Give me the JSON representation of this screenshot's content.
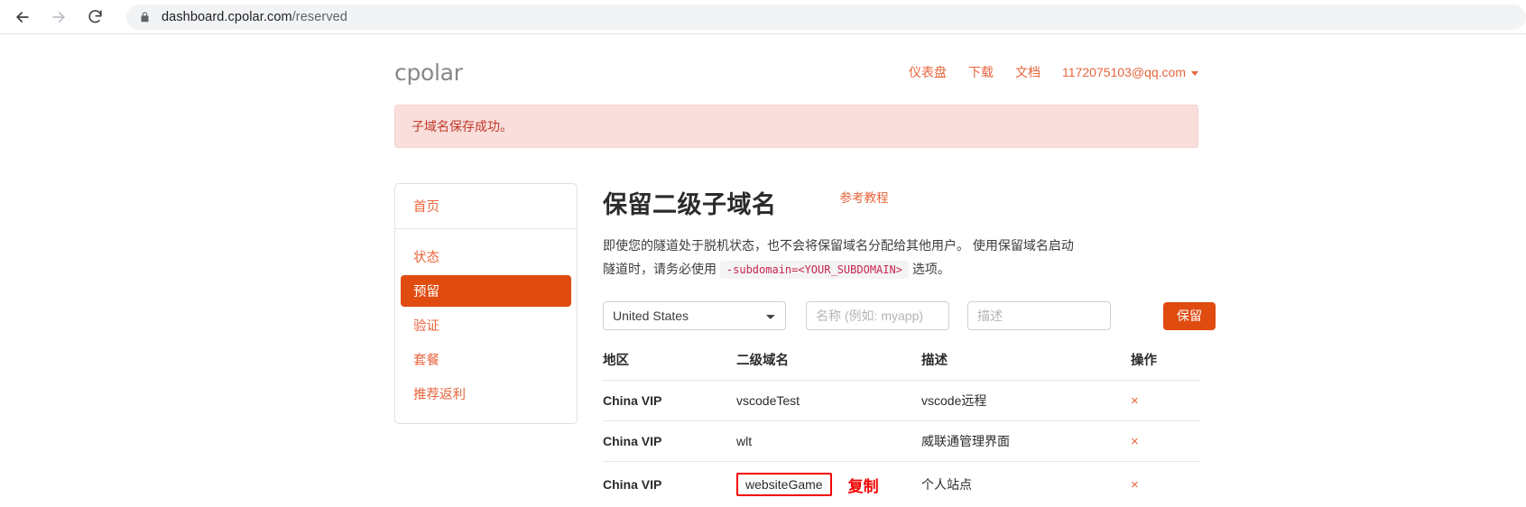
{
  "browser": {
    "back_icon": "arrow-left-icon",
    "forward_icon": "arrow-right-icon",
    "reload_icon": "reload-icon",
    "lock_icon": "lock-icon",
    "url_host": "dashboard.cpolar.com",
    "url_path": "/reserved"
  },
  "header": {
    "logo": "cpolar",
    "nav": [
      {
        "label": "仪表盘"
      },
      {
        "label": "下载"
      },
      {
        "label": "文档"
      },
      {
        "label": "1172075103@qq.com"
      }
    ]
  },
  "alert": {
    "message": "子域名保存成功。",
    "bg": "#f9dedb",
    "text_color": "#c0392b"
  },
  "sidebar": {
    "home": {
      "label": "首页"
    },
    "items": [
      {
        "label": "状态",
        "active": false
      },
      {
        "label": "预留",
        "active": true
      },
      {
        "label": "验证",
        "active": false
      },
      {
        "label": "套餐",
        "active": false
      },
      {
        "label": "推荐返利",
        "active": false
      }
    ],
    "active_bg": "#e04b10"
  },
  "main": {
    "title": "保留二级子域名",
    "tutorial_link": "参考教程",
    "description_part1": "即使您的隧道处于脱机状态，也不会将保留域名分配给其他用户。 使用保留域名启动隧道时，请务必使用",
    "description_code": "-subdomain=<YOUR_SUBDOMAIN>",
    "description_part2": "选项。",
    "form": {
      "region_value": "United States",
      "region_options": [
        "United States"
      ],
      "name_placeholder": "名称 (例如: myapp)",
      "name_value": "",
      "desc_placeholder": "描述",
      "desc_value": "",
      "submit_label": "保留"
    },
    "table": {
      "headers": [
        "地区",
        "二级域名",
        "描述",
        "操作"
      ],
      "rows": [
        {
          "region": "China VIP",
          "domain": "vscodeTest",
          "desc": "vscode远程",
          "action": "×",
          "highlighted": false,
          "annotation": ""
        },
        {
          "region": "China VIP",
          "domain": "wlt",
          "desc": "威联通管理界面",
          "action": "×",
          "highlighted": false,
          "annotation": ""
        },
        {
          "region": "China VIP",
          "domain": "websiteGame",
          "desc": "个人站点",
          "action": "×",
          "highlighted": true,
          "annotation": "复制"
        }
      ]
    }
  },
  "colors": {
    "brand_orange": "#e8643c",
    "active_orange": "#e04b10",
    "annotation_red": "#f20000"
  }
}
